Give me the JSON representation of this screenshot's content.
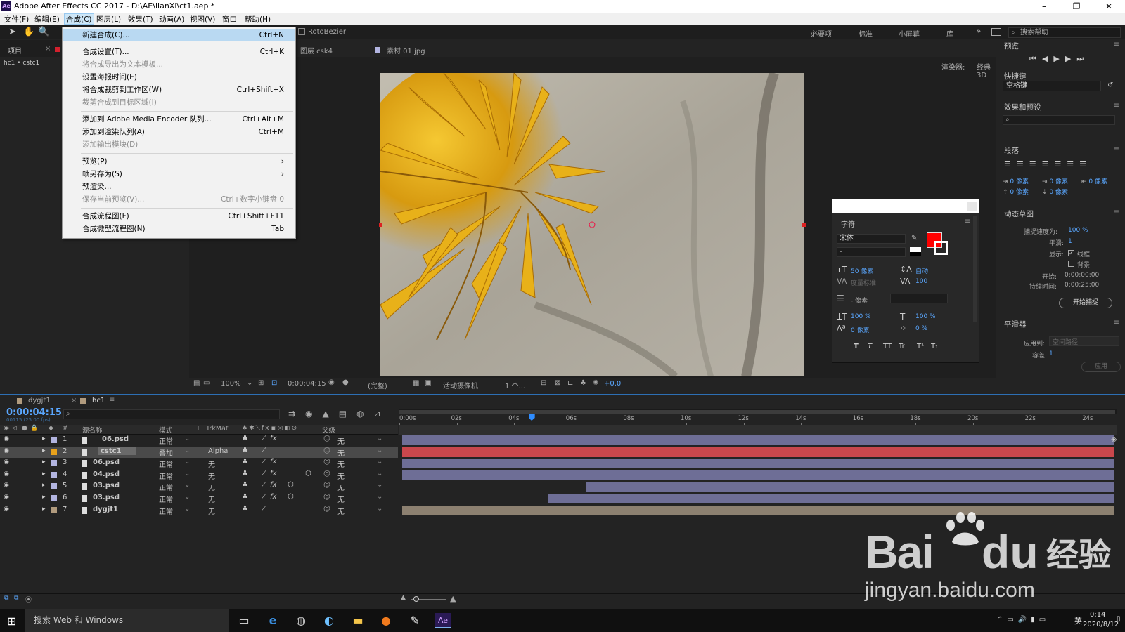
{
  "title_bar": {
    "title": "Adobe After Effects CC 2017 - D:\\AE\\lianXi\\ct1.aep *",
    "ae_logo": "Ae",
    "min": "–",
    "max": "❐",
    "close": "✕"
  },
  "menu": [
    "文件(F)",
    "编辑(E)",
    "合成(C)",
    "图层(L)",
    "效果(T)",
    "动画(A)",
    "视图(V)",
    "窗口",
    "帮助(H)"
  ],
  "toolbar": {
    "rotobezier": "RotoBezier",
    "workspaces": [
      "必要项",
      "标准",
      "小屏幕",
      "库"
    ],
    "more": "»",
    "search_help": "搜索帮助"
  },
  "dropdown": [
    {
      "label": "新建合成(C)...",
      "shortcut": "Ctrl+N",
      "state": "hl"
    },
    {
      "sep": true
    },
    {
      "label": "合成设置(T)...",
      "shortcut": "Ctrl+K"
    },
    {
      "label": "将合成导出为文本模板...",
      "shortcut": "",
      "state": "dis"
    },
    {
      "label": "设置海报时间(E)",
      "shortcut": ""
    },
    {
      "label": "将合成裁剪到工作区(W)",
      "shortcut": "Ctrl+Shift+X"
    },
    {
      "label": "裁剪合成到目标区域(I)",
      "shortcut": "",
      "state": "dis"
    },
    {
      "sep": true
    },
    {
      "label": "添加到 Adobe Media Encoder 队列...",
      "shortcut": "Ctrl+Alt+M"
    },
    {
      "label": "添加到渲染队列(A)",
      "shortcut": "Ctrl+M"
    },
    {
      "label": "添加输出模块(D)",
      "shortcut": "",
      "state": "dis"
    },
    {
      "sep": true
    },
    {
      "label": "预览(P)",
      "shortcut": "",
      "arrow": true
    },
    {
      "label": "帧另存为(S)",
      "shortcut": "",
      "arrow": true
    },
    {
      "label": "预渲染...",
      "shortcut": ""
    },
    {
      "label": "保存当前预览(V)...",
      "shortcut": "Ctrl+数字小键盘 0",
      "state": "dis"
    },
    {
      "sep": true
    },
    {
      "label": "合成流程图(F)",
      "shortcut": "Ctrl+Shift+F11"
    },
    {
      "label": "合成微型流程图(N)",
      "shortcut": "Tab"
    }
  ],
  "left_panel": {
    "tab": "项目",
    "breadcrumb": "hc1 • cstc1"
  },
  "comp_tabs": {
    "layer_tab": "图层 csk4",
    "footage_tab": "素材 01.jpg",
    "renderer_label": "渲染器:",
    "renderer": "经典 3D"
  },
  "viewer_controls": {
    "zoom": "100%",
    "time": "0:00:04:15",
    "quality": "(完整)",
    "camera": "活动摄像机",
    "views": "1 个...",
    "exposure": "+0.0"
  },
  "right_panel": {
    "preview_title": "预览",
    "shortcut_title": "快捷键",
    "shortcut_value": "空格键",
    "effects_title": "效果和预设",
    "paragraph_title": "段落",
    "para_values": [
      "0 像素",
      "0 像素",
      "0 像素",
      "0 像素",
      "0 像素"
    ],
    "motion_title": "动态草图",
    "capture_speed_label": "捕捉速度为:",
    "capture_speed": "100 %",
    "smooth_label": "平滑:",
    "smooth": "1",
    "show_label": "显示:",
    "wireframe": "线框",
    "background": "背景",
    "start_label": "开始:",
    "start": "0:00:00:00",
    "duration_label": "持续时间:",
    "duration": "0:00:25:00",
    "start_capture": "开始捕捉",
    "smoother_title": "平滑器",
    "apply_to_label": "应用到:",
    "apply_to": "空间路径",
    "tolerance_label": "容差:",
    "tolerance": "1",
    "apply": "应用"
  },
  "char_panel": {
    "title": "字符",
    "font": "宋体",
    "style": "-",
    "size": "50 像素",
    "leading": "自动",
    "kerning": "度量标准",
    "tracking": "100",
    "stroke": "- 像素",
    "vscale": "100 %",
    "hscale": "100 %",
    "baseline": "0 像素",
    "tsume": "0 %",
    "styles": [
      "T",
      "T",
      "TT",
      "Tr",
      "T¹",
      "T₁"
    ],
    "fill_color": "#ff0000"
  },
  "timeline": {
    "tabs": [
      "dygjt1",
      "hc1"
    ],
    "current_time": "0:00:04:15",
    "fps": "00115 (25.00 fps)",
    "col_headers": {
      "num": "#",
      "name": "源名称",
      "mode": "模式",
      "t": "T",
      "trkmat": "TrkMat",
      "parent": "父级"
    },
    "ruler": [
      "0:00s",
      "02s",
      "04s",
      "06s",
      "08s",
      "10s",
      "12s",
      "14s",
      "16s",
      "18s",
      "20s",
      "22s",
      "24s"
    ],
    "duration_s": 25,
    "playhead_s": 4.6,
    "layers": [
      {
        "num": "1",
        "name": "06.psd",
        "mode": "正常",
        "trkmat": "",
        "parent": "无",
        "color": "#b2b4e0",
        "bar_color": "#6e6e96",
        "start": 0,
        "end": 25,
        "fx": true,
        "shape": false
      },
      {
        "num": "2",
        "name": "cstc1",
        "mode": "叠加",
        "trkmat": "Alpha",
        "parent": "无",
        "color": "#e8a21c",
        "bar_color": "#c9474c",
        "start": 0,
        "end": 25,
        "fx": false,
        "shape": false,
        "selected": true
      },
      {
        "num": "3",
        "name": "06.psd",
        "mode": "正常",
        "trkmat": "无",
        "parent": "无",
        "color": "#b2b4e0",
        "bar_color": "#6e6e96",
        "start": 0,
        "end": 25,
        "fx": true,
        "shape": false
      },
      {
        "num": "4",
        "name": "04.psd",
        "mode": "正常",
        "trkmat": "无",
        "parent": "无",
        "color": "#b2b4e0",
        "bar_color": "#6e6e96",
        "start": 0,
        "end": 25,
        "fx": true,
        "shape": false,
        "cube": true
      },
      {
        "num": "5",
        "name": "03.psd",
        "mode": "正常",
        "trkmat": "无",
        "parent": "无",
        "color": "#b2b4e0",
        "bar_color": "#6e6e96",
        "start": 6.4,
        "end": 25,
        "fx": true,
        "shape": true
      },
      {
        "num": "6",
        "name": "03.psd",
        "mode": "正常",
        "trkmat": "无",
        "parent": "无",
        "color": "#b2b4e0",
        "bar_color": "#6e6e96",
        "start": 5.1,
        "end": 25,
        "fx": true,
        "shape": true
      },
      {
        "num": "7",
        "name": "dygjt1",
        "mode": "正常",
        "trkmat": "无",
        "parent": "无",
        "color": "#b19b7e",
        "bar_color": "#8c8070",
        "start": 0,
        "end": 25,
        "fx": false,
        "shape": false
      }
    ]
  },
  "taskbar": {
    "search": "搜索 Web 和 Windows",
    "time": "0:14",
    "date": "2020/8/12",
    "lang": "英"
  },
  "watermark": {
    "brand": "Bai",
    "brand2": "du",
    "brand_cn": "经验",
    "url": "jingyan.baidu.com"
  },
  "colors": {
    "blue_value": "#5aa7ff",
    "selected_layer": "#4a4a4a",
    "highlight": "#b9d9f2"
  },
  "icons": [
    "ae-logo-icon",
    "selection-tool-icon",
    "hand-tool-icon",
    "zoom-tool-icon",
    "search-icon",
    "menu-icon",
    "play-icon",
    "eye-icon",
    "audio-icon",
    "solo-icon",
    "lock-icon",
    "label-icon",
    "windows-start-icon",
    "edge-icon",
    "folder-icon",
    "firefox-icon",
    "ae-taskbar-icon",
    "network-icon",
    "volume-icon"
  ]
}
